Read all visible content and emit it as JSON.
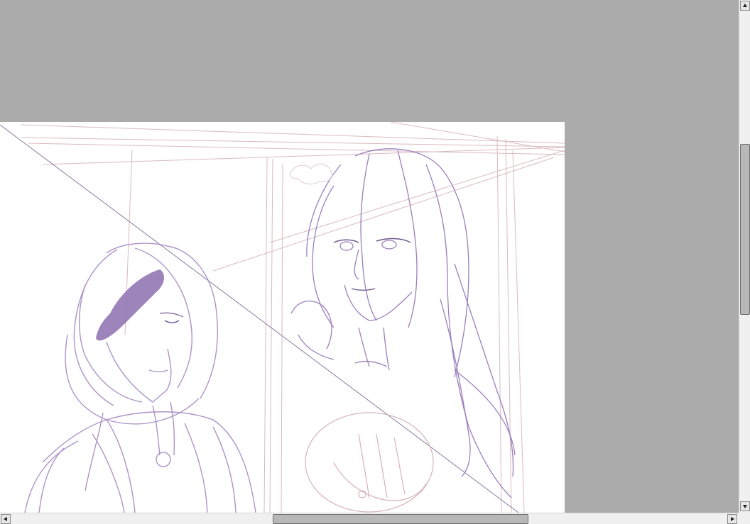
{
  "app": {
    "view": "drawing-canvas"
  },
  "colors": {
    "workspace_bg": "#ababab",
    "canvas_bg": "#ffffff",
    "sketch_line": "#9a7fb8",
    "sketch_dark": "#7b5a9e",
    "frame_line": "#c99aa6",
    "scrollbar_track": "#f0f0f0",
    "scrollbar_thumb": "#b8b8b8"
  },
  "scrollbars": {
    "vertical": {
      "up_icon": "arrow-up-icon",
      "down_icon": "arrow-down-icon",
      "thumb_fraction_start": 0.29,
      "thumb_fraction_size": 0.33
    },
    "horizontal": {
      "left_icon": "arrow-left-icon",
      "right_icon": "arrow-right-icon",
      "thumb_fraction_start": 0.37,
      "thumb_fraction_size": 0.35
    }
  }
}
